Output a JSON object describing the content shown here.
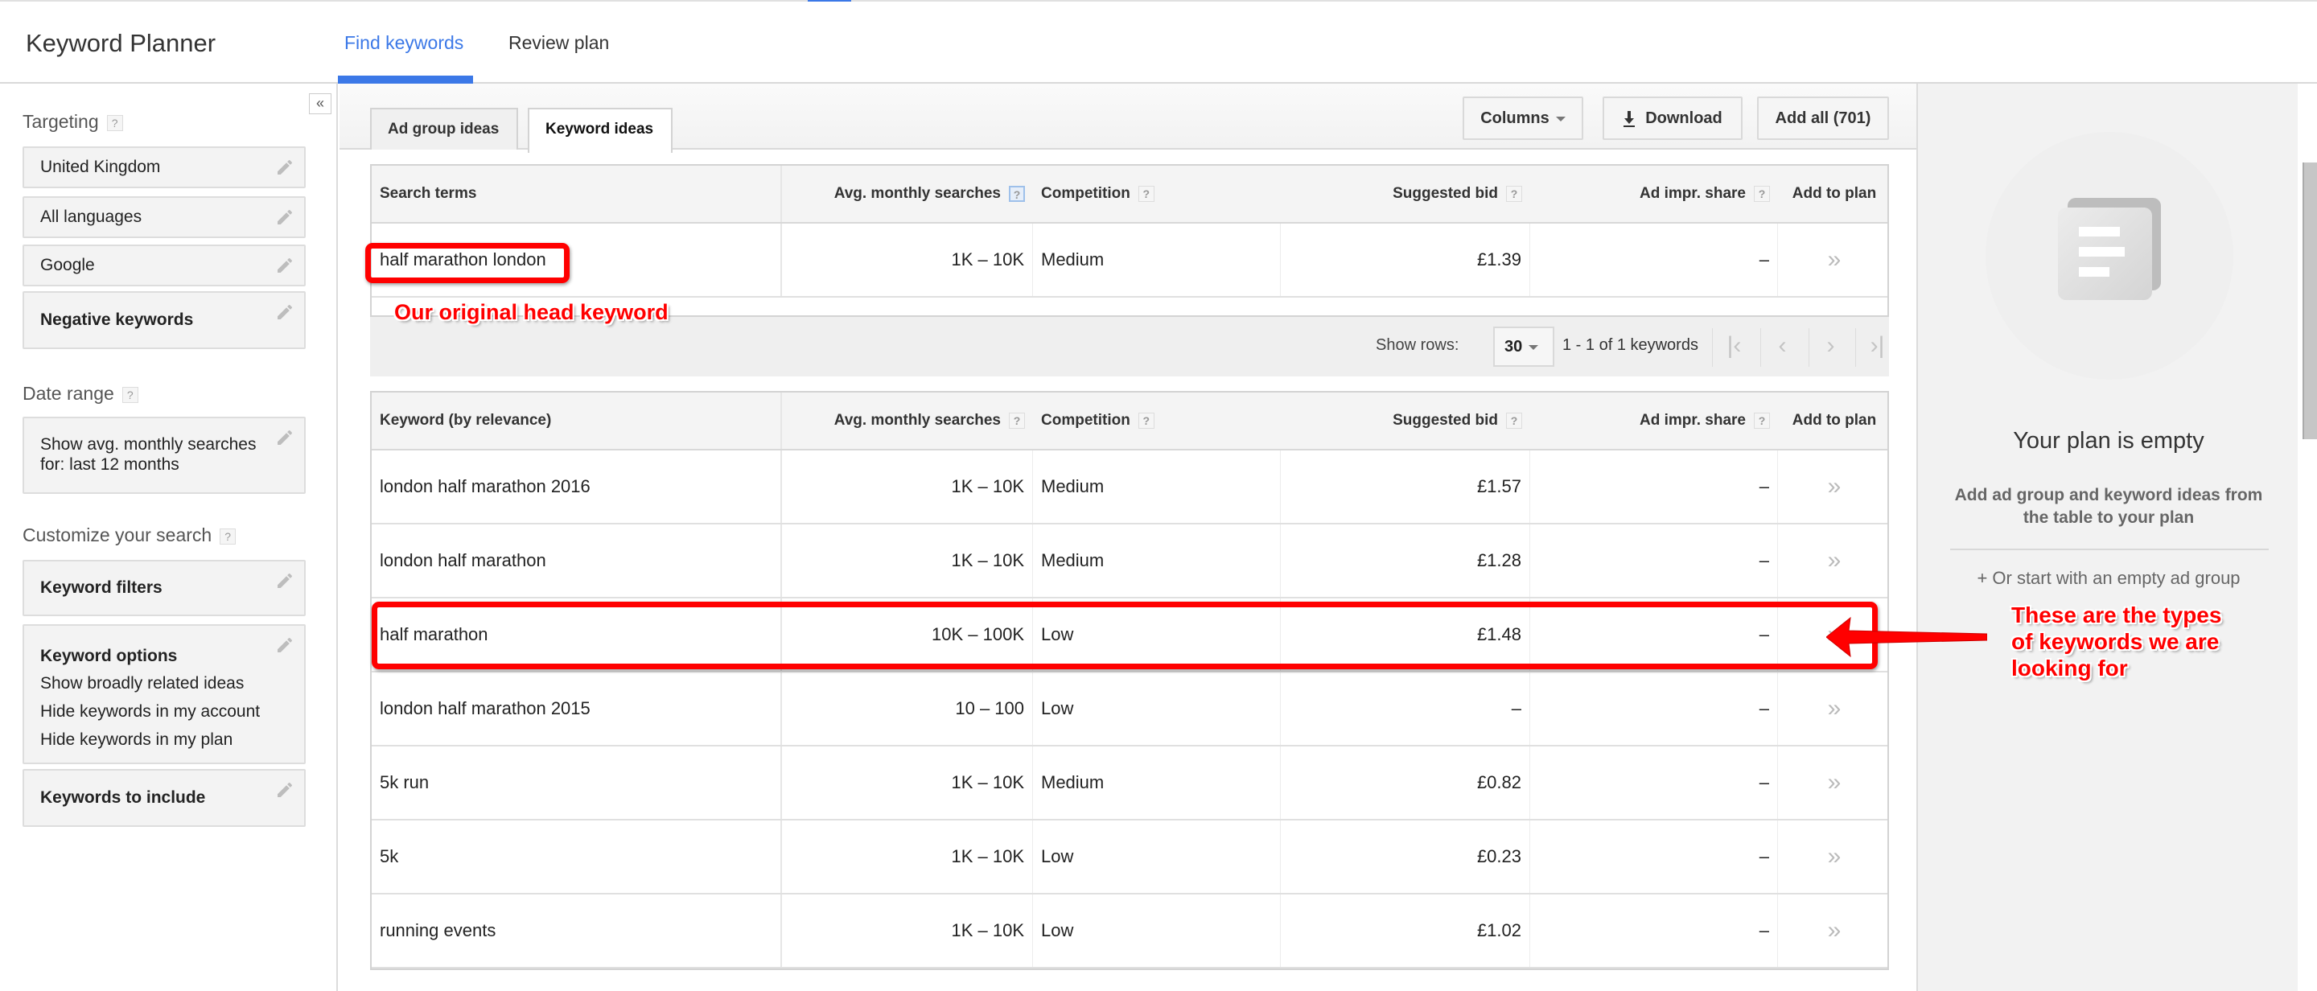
{
  "app": {
    "title": "Keyword Planner",
    "nav_tabs": [
      {
        "label": "Find keywords",
        "active": true
      },
      {
        "label": "Review plan",
        "active": false
      }
    ]
  },
  "sidebar": {
    "collapse_icon": "double-chevron-left",
    "targeting": {
      "heading": "Targeting",
      "help": "?",
      "items": [
        {
          "label": "United Kingdom",
          "icon": "pencil-icon"
        },
        {
          "label": "All languages",
          "icon": "pencil-icon"
        },
        {
          "label": "Google",
          "icon": "pencil-icon"
        },
        {
          "label": "Negative keywords",
          "icon": "pencil-icon",
          "bold": true
        }
      ]
    },
    "date_range": {
      "heading": "Date range",
      "help": "?",
      "line1": "Show avg. monthly searches",
      "line2": "for: last 12 months"
    },
    "customize": {
      "heading": "Customize your search",
      "help": "?",
      "keyword_filters": "Keyword filters",
      "keyword_options": {
        "title": "Keyword options",
        "lines": [
          "Show broadly related ideas",
          "Hide keywords in my account",
          "Hide keywords in my plan"
        ]
      },
      "keywords_to_include": "Keywords to include"
    }
  },
  "main": {
    "subtabs": [
      {
        "label": "Ad group ideas",
        "active": false
      },
      {
        "label": "Keyword ideas",
        "active": true
      }
    ],
    "toolbar": {
      "columns": "Columns",
      "download": "Download",
      "add_all": "Add all (701)"
    },
    "search_terms_table": {
      "headers": [
        "Search terms",
        "Avg. monthly searches",
        "Competition",
        "Suggested bid",
        "Ad impr. share",
        "Add to plan"
      ],
      "rows": [
        {
          "keyword": "half marathon london",
          "searches": "1K – 10K",
          "competition": "Medium",
          "bid": "£1.39",
          "impr": "–",
          "add": "»"
        }
      ]
    },
    "pager": {
      "show_rows_label": "Show rows:",
      "rows_value": "30",
      "count": "1 - 1 of 1 keywords",
      "first": "|‹",
      "prev": "‹",
      "next": "›",
      "last": "›|"
    },
    "keyword_ideas_table": {
      "headers": [
        "Keyword (by relevance)",
        "Avg. monthly searches",
        "Competition",
        "Suggested bid",
        "Ad impr. share",
        "Add to plan"
      ],
      "rows": [
        {
          "keyword": "london half marathon 2016",
          "searches": "1K – 10K",
          "competition": "Medium",
          "bid": "£1.57",
          "impr": "–",
          "add": "»"
        },
        {
          "keyword": "london half marathon",
          "searches": "1K – 10K",
          "competition": "Medium",
          "bid": "£1.28",
          "impr": "–",
          "add": "»"
        },
        {
          "keyword": "half marathon",
          "searches": "10K – 100K",
          "competition": "Low",
          "bid": "£1.48",
          "impr": "–",
          "add": "»"
        },
        {
          "keyword": "london half marathon 2015",
          "searches": "10 – 100",
          "competition": "Low",
          "bid": "–",
          "impr": "–",
          "add": "»"
        },
        {
          "keyword": "5k run",
          "searches": "1K – 10K",
          "competition": "Medium",
          "bid": "£0.82",
          "impr": "–",
          "add": "»"
        },
        {
          "keyword": "5k",
          "searches": "1K – 10K",
          "competition": "Low",
          "bid": "£0.23",
          "impr": "–",
          "add": "»"
        },
        {
          "keyword": "running events",
          "searches": "1K – 10K",
          "competition": "Low",
          "bid": "£1.02",
          "impr": "–",
          "add": "»"
        }
      ]
    }
  },
  "plan_panel": {
    "title": "Your plan is empty",
    "description": "Add ad group and keyword ideas from the table to your plan",
    "empty_group_link": "+ Or start with an empty ad group"
  },
  "annotations": {
    "head_keyword": "Our original head keyword",
    "types_line1": "These are the types",
    "types_line2": "of keywords we are",
    "types_line3": "looking for",
    "color": "#ff0000"
  },
  "colors": {
    "accent": "#3b78e7",
    "annotation": "#ff0000"
  }
}
